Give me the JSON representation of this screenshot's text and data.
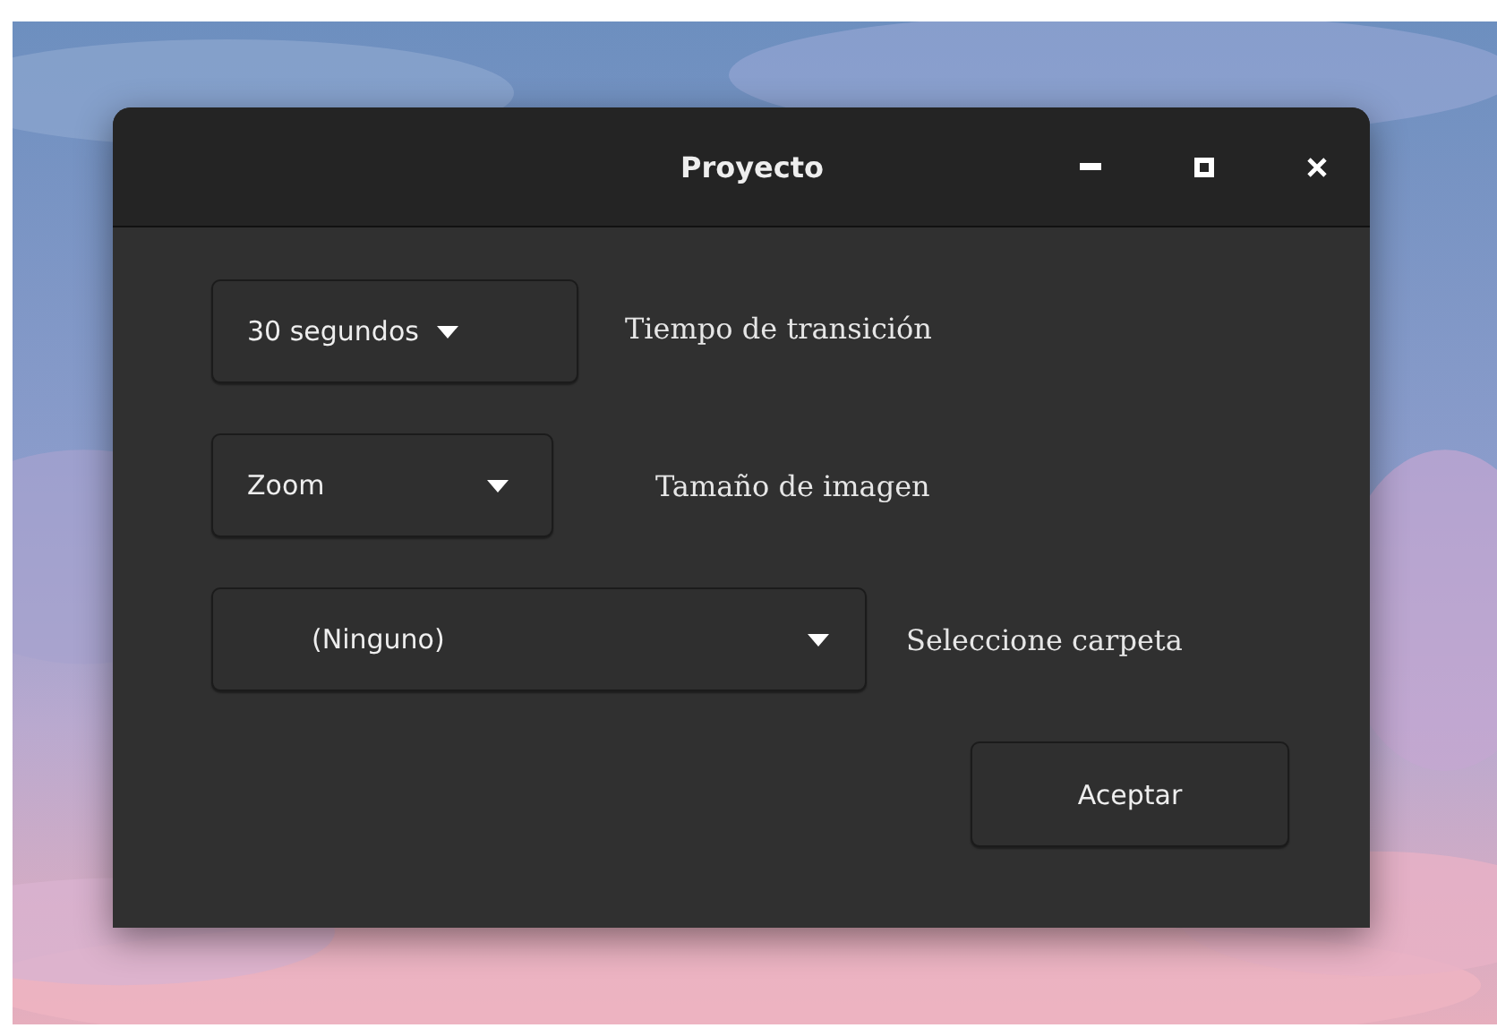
{
  "window": {
    "title": "Proyecto"
  },
  "settings": [
    {
      "value": "30 segundos",
      "label": "Tiempo de transición"
    },
    {
      "value": "Zoom",
      "label": "Tamaño de imagen"
    },
    {
      "value": "(Ninguno)",
      "label": "Seleccione carpeta"
    }
  ],
  "buttons": [
    "Aceptar"
  ]
}
